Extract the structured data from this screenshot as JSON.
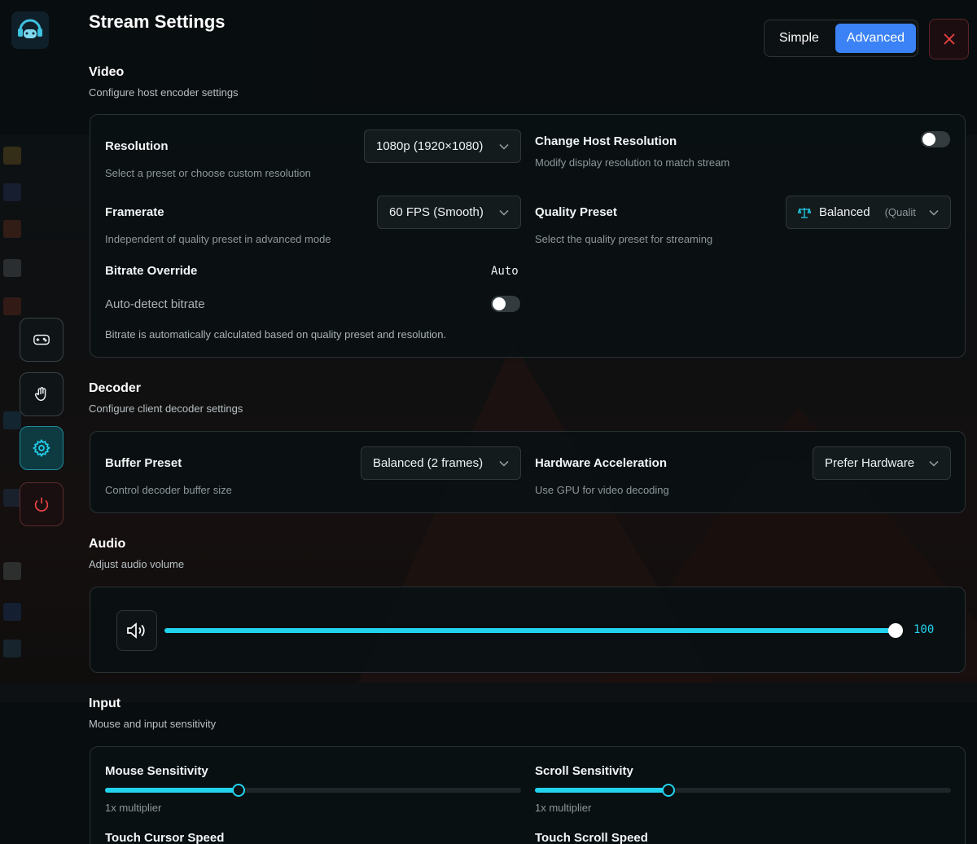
{
  "header": {
    "title": "Stream Settings",
    "mode_simple": "Simple",
    "mode_advanced": "Advanced",
    "selected_mode": "Advanced"
  },
  "rail": {
    "items": [
      {
        "name": "gamepad",
        "icon": "gamepad-icon",
        "active": false
      },
      {
        "name": "touch",
        "icon": "hand-icon",
        "active": false
      },
      {
        "name": "settings",
        "icon": "gear-icon",
        "active": true
      },
      {
        "name": "power",
        "icon": "power-icon",
        "active": false
      }
    ]
  },
  "video": {
    "title": "Video",
    "desc": "Configure host encoder settings",
    "resolution": {
      "label": "Resolution",
      "sub": "Select a preset or choose custom resolution",
      "value": "1080p (1920×1080)"
    },
    "change_host": {
      "label": "Change Host Resolution",
      "sub": "Modify display resolution to match stream",
      "on": false
    },
    "framerate": {
      "label": "Framerate",
      "sub": "Independent of quality preset in advanced mode",
      "value": "60 FPS (Smooth)"
    },
    "quality": {
      "label": "Quality Preset",
      "sub": "Select the quality preset for streaming",
      "value": "Balanced",
      "hint": "(Qualit"
    },
    "bitrate": {
      "label": "Bitrate Override",
      "value": "Auto",
      "auto_label": "Auto-detect bitrate",
      "auto_on": false,
      "note": "Bitrate is automatically calculated based on quality preset and resolution."
    }
  },
  "decoder": {
    "title": "Decoder",
    "desc": "Configure client decoder settings",
    "buffer": {
      "label": "Buffer Preset",
      "sub": "Control decoder buffer size",
      "value": "Balanced (2 frames)"
    },
    "hwaccel": {
      "label": "Hardware Acceleration",
      "sub": "Use GPU for video decoding",
      "value": "Prefer Hardware"
    }
  },
  "audio": {
    "title": "Audio",
    "desc": "Adjust audio volume",
    "volume": 100,
    "volume_label": "100"
  },
  "input": {
    "title": "Input",
    "desc": "Mouse and input sensitivity",
    "mouse": {
      "label": "Mouse Sensitivity",
      "sub": "1x multiplier",
      "level": 0.32
    },
    "scroll": {
      "label": "Scroll Sensitivity",
      "sub": "1x multiplier",
      "level": 0.32
    },
    "touch_cursor": {
      "label": "Touch Cursor Speed"
    },
    "touch_scroll": {
      "label": "Touch Scroll Speed"
    }
  },
  "colors": {
    "accent": "#22d3ee",
    "primary": "#3b82f6",
    "danger": "#ef4444"
  }
}
